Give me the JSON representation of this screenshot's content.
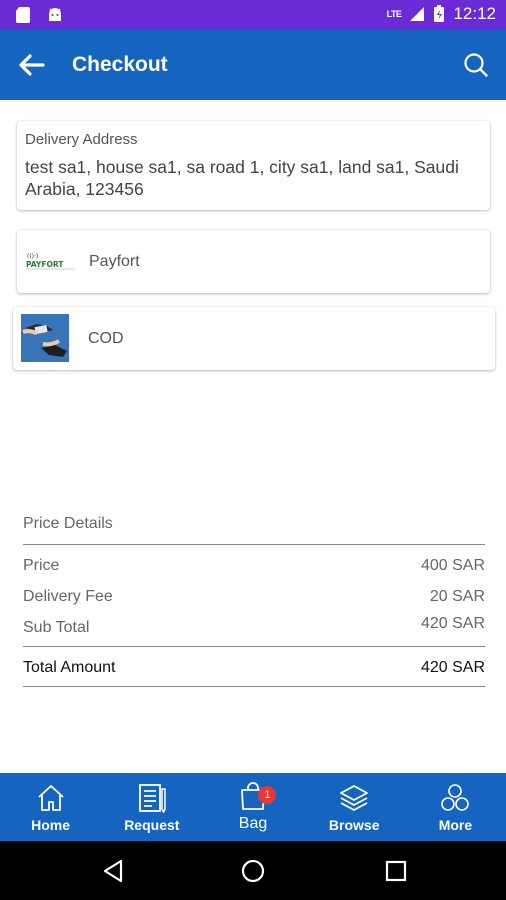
{
  "status_bar": {
    "time": "12:12",
    "network": "LTE"
  },
  "app_bar": {
    "title": "Checkout"
  },
  "delivery": {
    "label": "Delivery Address",
    "address": "test sa1, house sa1, sa road 1, city sa1, land sa1, Saudi Arabia, 123456"
  },
  "payment_methods": [
    {
      "label": "Payfort",
      "logo_text": "PAYFORT"
    },
    {
      "label": "COD"
    }
  ],
  "price_details": {
    "heading": "Price Details",
    "rows": [
      {
        "label": "Price",
        "value": "400 SAR"
      },
      {
        "label": "Delivery Fee",
        "value": "20 SAR"
      },
      {
        "label": "Sub Total",
        "value": "420 SAR"
      }
    ],
    "total": {
      "label": "Total Amount",
      "value": "420 SAR"
    }
  },
  "bottom_nav": {
    "items": [
      {
        "label": "Home",
        "icon": "home-icon"
      },
      {
        "label": "Request",
        "icon": "request-icon"
      },
      {
        "label": "Bag",
        "icon": "bag-icon",
        "badge": "1"
      },
      {
        "label": "Browse",
        "icon": "layers-icon"
      },
      {
        "label": "More",
        "icon": "more-icon"
      }
    ]
  },
  "colors": {
    "status_bar": "#6a2bd6",
    "primary": "#1565c0",
    "badge": "#e53935"
  }
}
